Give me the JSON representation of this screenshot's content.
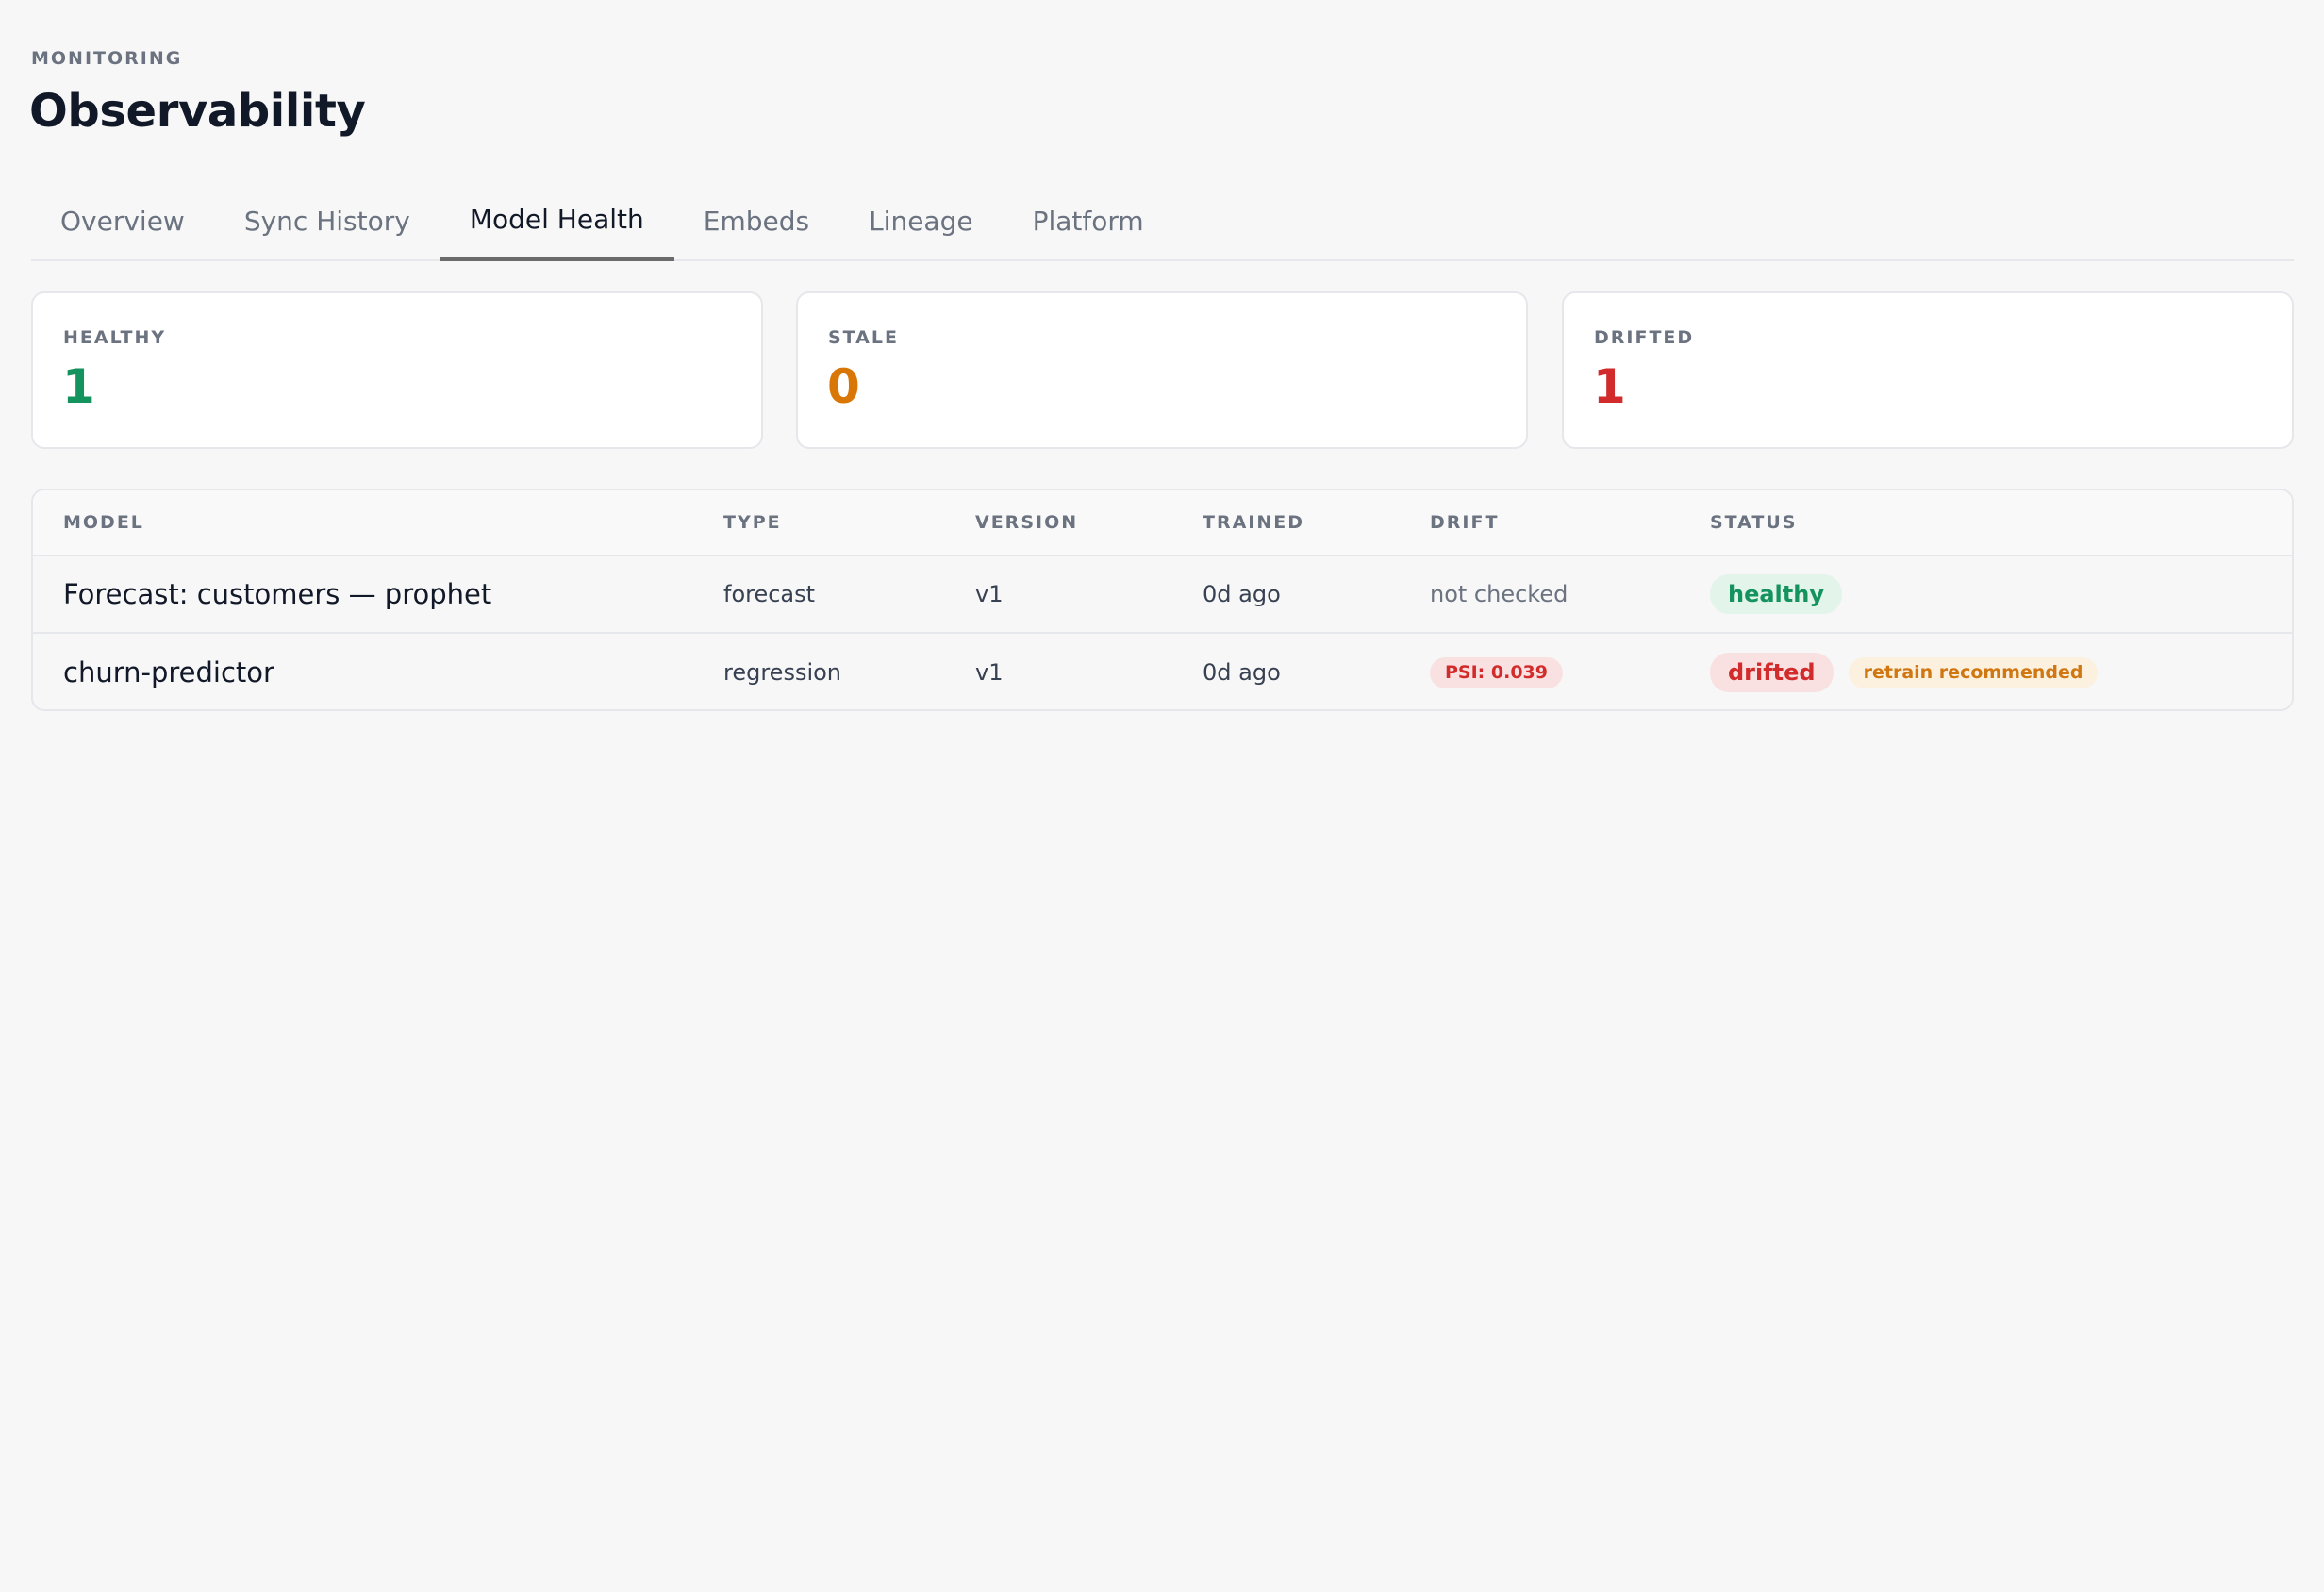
{
  "header": {
    "eyebrow": "MONITORING",
    "title": "Observability"
  },
  "tabs": [
    {
      "label": "Overview",
      "active": false
    },
    {
      "label": "Sync History",
      "active": false
    },
    {
      "label": "Model Health",
      "active": true
    },
    {
      "label": "Embeds",
      "active": false
    },
    {
      "label": "Lineage",
      "active": false
    },
    {
      "label": "Platform",
      "active": false
    }
  ],
  "summary": {
    "healthy": {
      "label": "HEALTHY",
      "value": "1",
      "color": "#15935f"
    },
    "stale": {
      "label": "STALE",
      "value": "0",
      "color": "#d97706"
    },
    "drifted": {
      "label": "DRIFTED",
      "value": "1",
      "color": "#d22b2b"
    }
  },
  "table": {
    "columns": [
      "MODEL",
      "TYPE",
      "VERSION",
      "TRAINED",
      "DRIFT",
      "STATUS"
    ],
    "rows": [
      {
        "model": "Forecast: customers — prophet",
        "type": "forecast",
        "version": "v1",
        "trained": "0d ago",
        "drift": "not checked",
        "status": "healthy"
      },
      {
        "model": "churn-predictor",
        "type": "regression",
        "version": "v1",
        "trained": "0d ago",
        "drift": "PSI: 0.039",
        "status": "drifted",
        "note": "retrain recommended"
      }
    ]
  }
}
